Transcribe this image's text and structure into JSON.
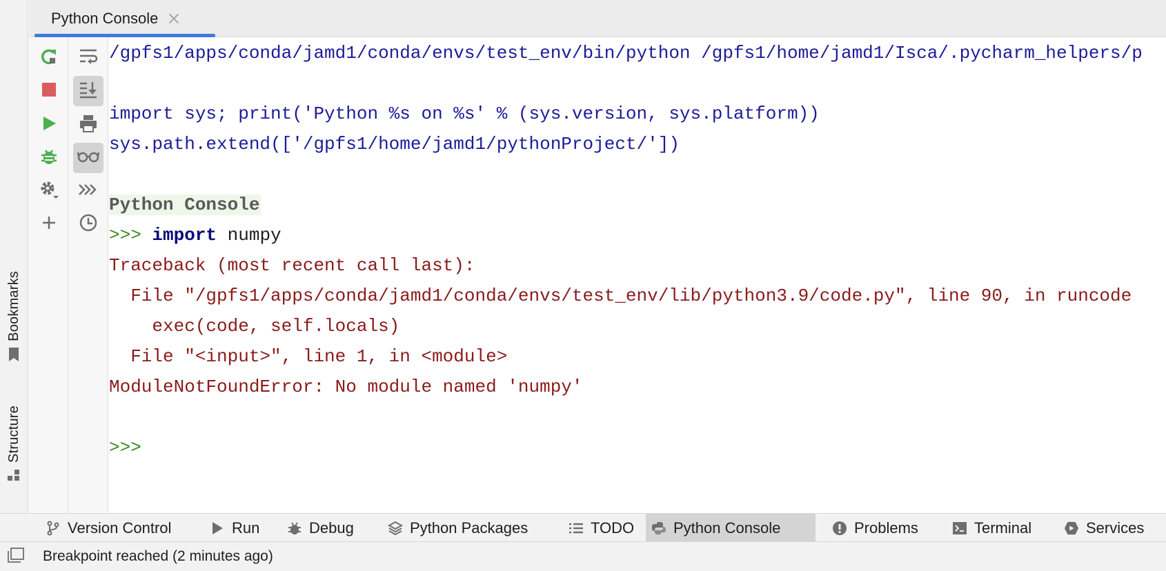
{
  "tab": {
    "title": "Python Console"
  },
  "left_stripe": {
    "bookmarks": "Bookmarks",
    "structure": "Structure"
  },
  "console": {
    "lines": [
      "/gpfs1/apps/conda/jamd1/conda/envs/test_env/bin/python /gpfs1/home/jamd1/Isca/.pycharm_helpers/p",
      "import sys; print('Python %s on %s' % (sys.version, sys.platform))",
      "sys.path.extend(['/gpfs1/home/jamd1/pythonProject/'])",
      "Python Console",
      ">>> ",
      "import",
      " numpy",
      "Traceback (most recent call last):",
      "  File \"/gpfs1/apps/conda/jamd1/conda/envs/test_env/lib/python3.9/code.py\", line 90, in runcode",
      "    exec(code, self.locals)",
      "  File \"<input>\", line 1, in <module>",
      "ModuleNotFoundError: No module named 'numpy'",
      ">>>"
    ]
  },
  "bottom_tabs": [
    "Version Control",
    "Run",
    "Debug",
    "Python Packages",
    "TODO",
    "Python Console",
    "Problems",
    "Terminal",
    "Services"
  ],
  "status": {
    "message": "Breakpoint reached (2 minutes ago)"
  },
  "colors": {
    "accent": "#3d7ddb",
    "run_green": "#4caf50",
    "stop_red": "#db5c5c",
    "console_blue": "#1c1c99",
    "error_red": "#8a1b1b",
    "prompt_green": "#3a8a1e"
  },
  "icons": {
    "toolbar_left": [
      "rerun-icon",
      "stop-icon",
      "run-icon",
      "debug-icon",
      "settings-icon",
      "add-icon"
    ],
    "toolbar_right": [
      "soft-wrap-icon",
      "scroll-to-end-icon",
      "print-icon",
      "show-variables-icon",
      "command-queue-icon",
      "history-icon"
    ]
  }
}
